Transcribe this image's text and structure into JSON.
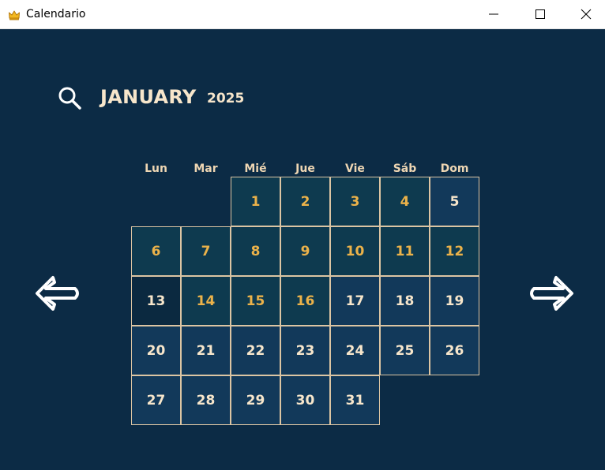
{
  "window": {
    "title": "Calendario",
    "icon": "crown-icon",
    "controls": [
      "minimize-icon",
      "maximize-icon",
      "close-icon"
    ]
  },
  "header": {
    "month": "JANUARY",
    "year": "2025",
    "search_icon": "search-icon"
  },
  "weekdays": [
    "Lun",
    "Mar",
    "Mié",
    "Jue",
    "Vie",
    "Sáb",
    "Dom"
  ],
  "days": [
    {
      "label": "1",
      "status": "past"
    },
    {
      "label": "2",
      "status": "past"
    },
    {
      "label": "3",
      "status": "past"
    },
    {
      "label": "4",
      "status": "past"
    },
    {
      "label": "5",
      "status": "future"
    },
    {
      "label": "6",
      "status": "past"
    },
    {
      "label": "7",
      "status": "past"
    },
    {
      "label": "8",
      "status": "past"
    },
    {
      "label": "9",
      "status": "past"
    },
    {
      "label": "10",
      "status": "past"
    },
    {
      "label": "11",
      "status": "past"
    },
    {
      "label": "12",
      "status": "past"
    },
    {
      "label": "13",
      "status": "today"
    },
    {
      "label": "14",
      "status": "past"
    },
    {
      "label": "15",
      "status": "past"
    },
    {
      "label": "16",
      "status": "past"
    },
    {
      "label": "17",
      "status": "future"
    },
    {
      "label": "18",
      "status": "future"
    },
    {
      "label": "19",
      "status": "future"
    },
    {
      "label": "20",
      "status": "future"
    },
    {
      "label": "21",
      "status": "future"
    },
    {
      "label": "22",
      "status": "future"
    },
    {
      "label": "23",
      "status": "future"
    },
    {
      "label": "24",
      "status": "future"
    },
    {
      "label": "25",
      "status": "future"
    },
    {
      "label": "26",
      "status": "future"
    },
    {
      "label": "27",
      "status": "future"
    },
    {
      "label": "28",
      "status": "future"
    },
    {
      "label": "29",
      "status": "future"
    },
    {
      "label": "30",
      "status": "future"
    },
    {
      "label": "31",
      "status": "future"
    }
  ],
  "navigation": {
    "prev_icon": "left-arrow-icon",
    "next_icon": "right-arrow-icon"
  },
  "colors": {
    "background": "#0c2b45",
    "cream_text": "#f7e6cb",
    "accent_orange": "#ebb24a",
    "cell_border": "#dcc5a3"
  }
}
